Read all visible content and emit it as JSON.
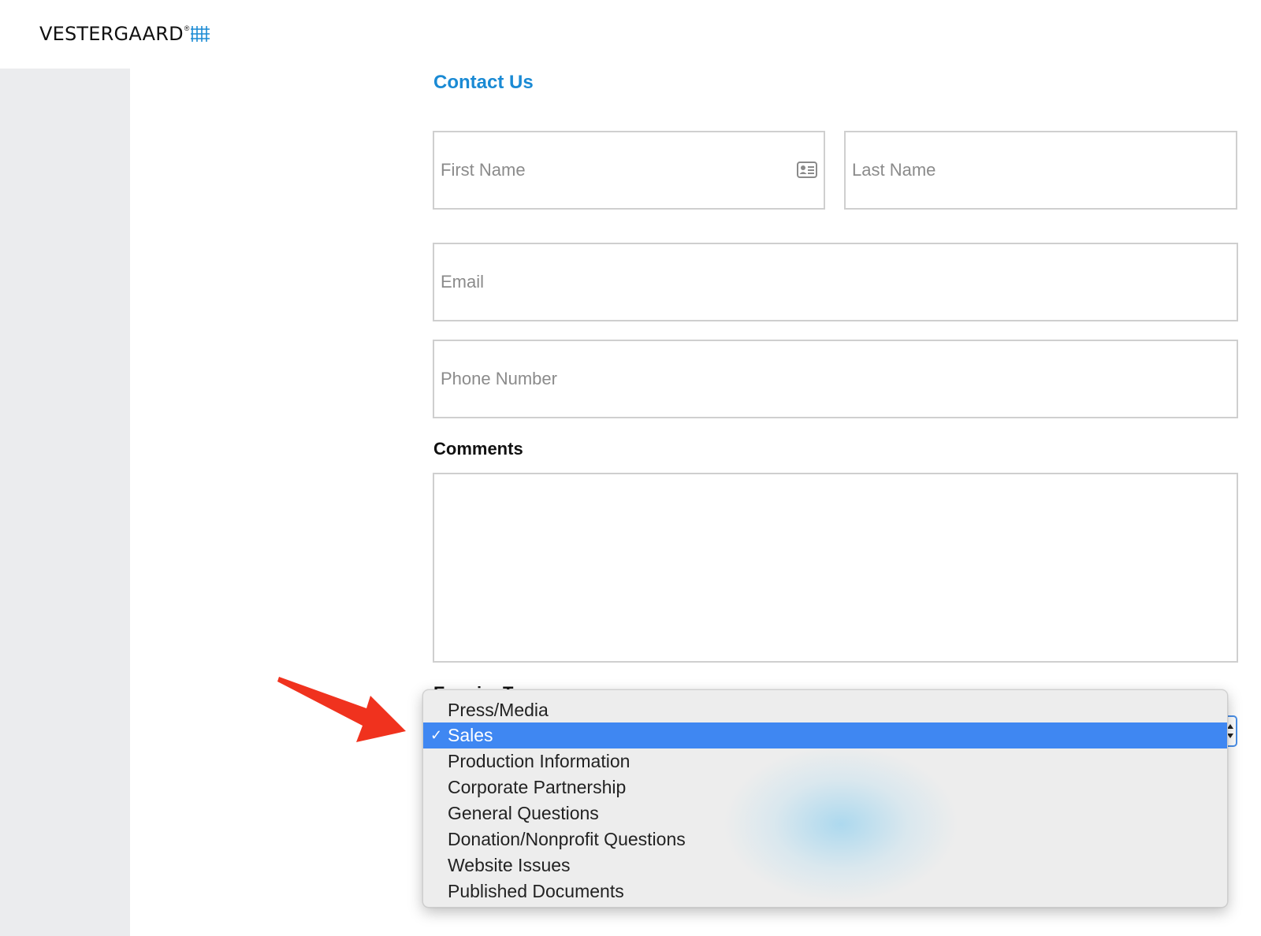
{
  "header": {
    "logo_text": "VESTERGAARD",
    "logo_reg": "®"
  },
  "page": {
    "title": "Contact Us"
  },
  "form": {
    "first_name": {
      "placeholder": "First Name",
      "value": ""
    },
    "last_name": {
      "placeholder": "Last Name",
      "value": ""
    },
    "email": {
      "placeholder": "Email",
      "value": ""
    },
    "phone": {
      "placeholder": "Phone Number",
      "value": ""
    },
    "comments_label": "Comments",
    "comments_value": "",
    "inquiry_label": "Enquiry Type",
    "inquiry_select": {
      "selected": "Sales",
      "options": [
        "Press/Media",
        "Sales",
        "Production Information",
        "Corporate Partnership",
        "General Questions",
        "Donation/Nonprofit Questions",
        "Website Issues",
        "Published Documents"
      ],
      "check_glyph": "✓"
    }
  },
  "colors": {
    "accent_title": "#1a8ad4",
    "selection": "#3f87f2",
    "annotation_arrow": "#f0321e",
    "logo_grid": "#1a8ad4"
  },
  "icons": {
    "first_name_icon": "contact-card-icon",
    "annotation": "red-arrow-icon"
  }
}
